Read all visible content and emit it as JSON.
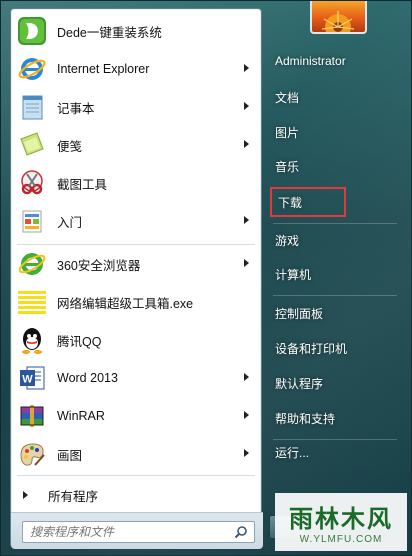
{
  "programs": [
    {
      "label": "Dede一键重装系统",
      "icon": "dede-icon",
      "submenu": false
    },
    {
      "label": "Internet Explorer",
      "icon": "internet-explorer-icon",
      "submenu": true
    },
    {
      "label": "记事本",
      "icon": "notepad-icon",
      "submenu": true
    },
    {
      "label": "便笺",
      "icon": "sticky-notes-icon",
      "submenu": true
    },
    {
      "label": "截图工具",
      "icon": "snipping-tool-icon",
      "submenu": false
    },
    {
      "label": "入门",
      "icon": "getting-started-icon",
      "submenu": true
    },
    {
      "label": "360安全浏览器",
      "icon": "360-browser-icon",
      "submenu": true
    },
    {
      "label": "网络编辑超级工具箱.exe",
      "icon": "toolbox-icon",
      "submenu": false
    },
    {
      "label": "腾讯QQ",
      "icon": "qq-icon",
      "submenu": false
    },
    {
      "label": "Word 2013",
      "icon": "word-icon",
      "submenu": true
    },
    {
      "label": "WinRAR",
      "icon": "winrar-icon",
      "submenu": true
    },
    {
      "label": "画图",
      "icon": "paint-icon",
      "submenu": true
    }
  ],
  "all_programs_label": "所有程序",
  "search": {
    "placeholder": "搜索程序和文件"
  },
  "right_items": [
    {
      "label": "Administrator"
    },
    {
      "label": "文档"
    },
    {
      "label": "图片"
    },
    {
      "label": "音乐"
    },
    {
      "label": "下载",
      "highlighted": true
    },
    {
      "label": "游戏"
    },
    {
      "label": "计算机"
    },
    {
      "label": "控制面板"
    },
    {
      "label": "设备和打印机"
    },
    {
      "label": "默认程序"
    },
    {
      "label": "帮助和支持"
    },
    {
      "label": "运行..."
    }
  ],
  "watermark": {
    "logo": "雨林木风",
    "url": "W.YLMFU.COM"
  },
  "colors": {
    "highlight_border": "#e23a3a",
    "panel_bg": "#ffffff"
  }
}
